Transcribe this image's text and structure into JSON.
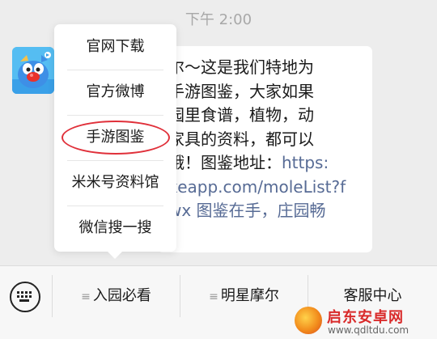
{
  "chat": {
    "timestamp": "下午 2:00",
    "message_lines": [
      "尔～这是我们特地为",
      "手游图鉴，大家如果",
      "园里食谱，植物，动",
      "家具的资料，都可以",
      "哦！图鉴地址：",
      "xeapp.com/moleList?f",
      "wx 图鉴在手，庄园畅"
    ],
    "link_start": "https:"
  },
  "popup_menu": {
    "items": [
      "官网下载",
      "官方微博",
      "手游图鉴",
      "米米号资料馆",
      "微信搜一搜"
    ],
    "highlighted_index": 2,
    "highlight_color": "#e0303a"
  },
  "bottom_menu": {
    "keyboard_icon": "keyboard-icon",
    "items": [
      "入园必看",
      "明星摩尔",
      "客服中心"
    ]
  },
  "watermark": {
    "title": "启东安卓网",
    "url": "www.qdltdu.com"
  },
  "colors": {
    "link": "#576b95",
    "background": "#ededed"
  }
}
